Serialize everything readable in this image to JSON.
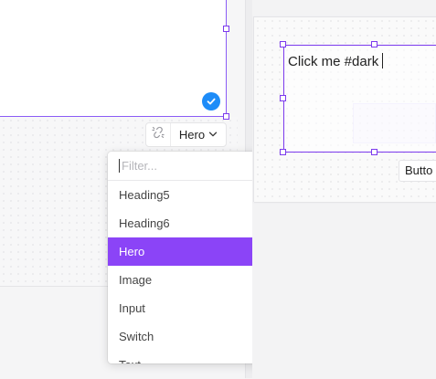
{
  "toolbar": {
    "component_label": "Hero",
    "unlink_icon": "unlink-icon",
    "chevron_icon": "chevron-down-icon"
  },
  "dropdown": {
    "filter_placeholder": "Filter...",
    "options": [
      "Heading5",
      "Heading6",
      "Hero",
      "Image",
      "Input",
      "Switch",
      "Text"
    ],
    "selected": "Hero"
  },
  "canvas": {
    "text_content": "Click me #dark",
    "button_chip_label": "Butto"
  },
  "colors": {
    "accent": "#8b44f7",
    "selection_border": "#7c3aed",
    "check_badge": "#1d8cf8"
  }
}
